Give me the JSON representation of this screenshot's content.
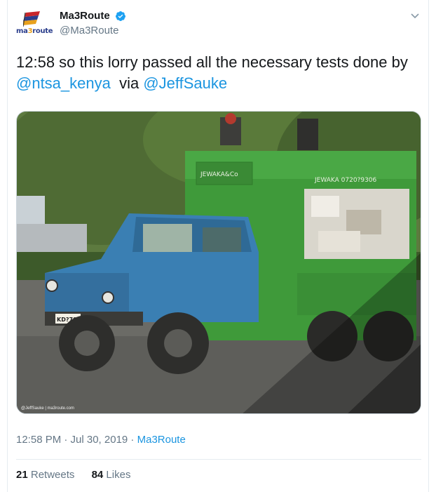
{
  "tweet": {
    "author": {
      "display_name": "Ma3Route",
      "handle": "@Ma3Route",
      "verified": true,
      "avatar_logo": {
        "part1": "ma",
        "part2": "3",
        "part3": "route"
      }
    },
    "menu_icon": "chevron-down-icon",
    "text_segments": [
      {
        "text": "12:58 so this lorry passed all the necessary tests done by ",
        "type": "text"
      },
      {
        "text": "@ntsa_kenya",
        "type": "mention"
      },
      {
        "text": "  via ",
        "type": "text"
      },
      {
        "text": "@JeffSauke",
        "type": "mention"
      }
    ],
    "media": {
      "description_icon": "photo-lorry",
      "truck_sign_left": "JEWAKA&Co",
      "truck_sign_right": "JEWAKA  0720?9306",
      "plate": "KD?7096",
      "watermark": "@JeffSauke | ma3route.com"
    },
    "timestamp": "12:58 PM · Jul 30, 2019",
    "separator": " · ",
    "source": "Ma3Route",
    "retweets": {
      "count": "21",
      "label": "Retweets"
    },
    "likes": {
      "count": "84",
      "label": "Likes"
    }
  },
  "colors": {
    "link": "#1b95e0",
    "secondary_text": "#657786",
    "primary_text": "#14171a",
    "divider": "#e6ecf0"
  }
}
